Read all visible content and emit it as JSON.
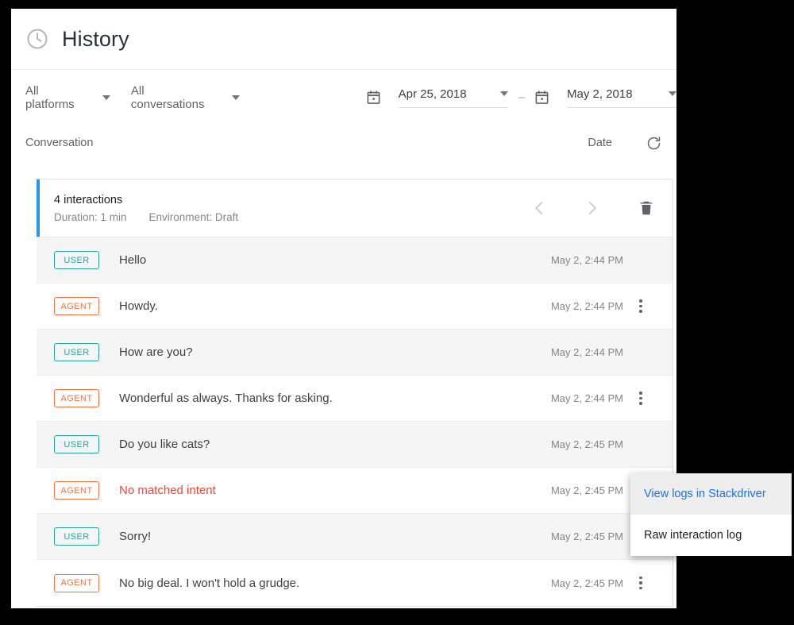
{
  "header": {
    "title": "History",
    "icon": "clock-icon"
  },
  "filters": {
    "platform": {
      "label": "All platforms",
      "icon": "chevron-down-icon"
    },
    "conversation": {
      "label": "All conversations",
      "icon": "chevron-down-icon"
    },
    "date_range": {
      "start": "Apr 25, 2018",
      "end": "May 2, 2018",
      "separator": "–",
      "icon": "calendar-icon"
    }
  },
  "table": {
    "columns": {
      "conversation": "Conversation",
      "date": "Date"
    },
    "refresh_icon": "refresh-icon"
  },
  "conversation": {
    "summary": {
      "title": "4 interactions",
      "duration": "Duration: 1 min",
      "environment": "Environment: Draft"
    },
    "actions": {
      "prev_icon": "chevron-left-icon",
      "next_icon": "chevron-right-icon",
      "delete_icon": "trash-icon"
    },
    "accent_color": "#2196f3",
    "messages": [
      {
        "role": "USER",
        "text": "Hello",
        "time": "May 2, 2:44 PM",
        "status": "none",
        "menu": "none"
      },
      {
        "role": "AGENT",
        "text": "Howdy.",
        "time": "May 2, 2:44 PM",
        "status": "none",
        "menu": "kebab"
      },
      {
        "role": "USER",
        "text": "How are you?",
        "time": "May 2, 2:44 PM",
        "status": "none",
        "menu": "none"
      },
      {
        "role": "AGENT",
        "text": "Wonderful as always. Thanks for asking.",
        "time": "May 2, 2:44 PM",
        "status": "none",
        "menu": "kebab"
      },
      {
        "role": "USER",
        "text": "Do you like cats?",
        "time": "May 2, 2:45 PM",
        "status": "none",
        "menu": "none"
      },
      {
        "role": "AGENT",
        "text": "No matched intent",
        "time": "May 2, 2:45 PM",
        "status": "error",
        "menu": "none"
      },
      {
        "role": "USER",
        "text": "Sorry!",
        "time": "May 2, 2:45 PM",
        "status": "none",
        "menu": "none"
      },
      {
        "role": "AGENT",
        "text": "No big deal. I won't hold a grudge.",
        "time": "May 2, 2:45 PM",
        "status": "none",
        "menu": "kebab"
      }
    ]
  },
  "popup_menu": {
    "items": [
      {
        "label": "View logs in Stackdriver",
        "state": "highlighted"
      },
      {
        "label": "Raw interaction log",
        "state": "normal"
      }
    ]
  },
  "colors": {
    "accent": "#2196f3",
    "user_badge": "#26a69a",
    "agent_badge": "#f4713b",
    "error": "#f44336",
    "link": "#1a73e8"
  }
}
